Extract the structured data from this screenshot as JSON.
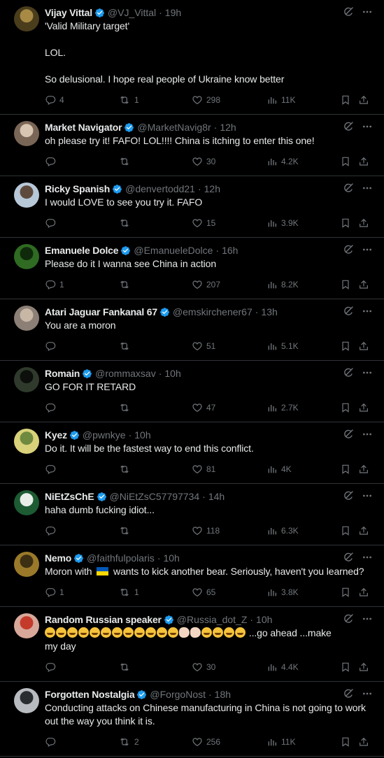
{
  "tweets": [
    {
      "name": "Vijay Vittal",
      "handle": "@VJ_Vittal",
      "time": "19h",
      "lines": [
        "'Valid Military target'",
        "",
        "LOL.",
        "",
        "So delusional. I hope real people of Ukraine know better"
      ],
      "replies": "4",
      "retweets": "1",
      "likes": "298",
      "views": "11K",
      "avatar_colors": [
        "#4a3d1c",
        "#a88a44"
      ]
    },
    {
      "name": "Market Navigator",
      "handle": "@MarketNavig8r",
      "time": "12h",
      "lines": [
        "oh please try it!  FAFO! LOL!!!!  China is itching to enter this one!"
      ],
      "replies": "",
      "retweets": "",
      "likes": "30",
      "views": "4.2K",
      "avatar_colors": [
        "#7a6656",
        "#d8c6b2"
      ]
    },
    {
      "name": "Ricky Spanish",
      "handle": "@denvertodd21",
      "time": "12h",
      "lines": [
        "I would LOVE to see you try it. FAFO"
      ],
      "replies": "",
      "retweets": "",
      "likes": "15",
      "views": "3.9K",
      "avatar_colors": [
        "#b7c8d8",
        "#5e4a3d"
      ]
    },
    {
      "name": "Emanuele Dolce",
      "handle": "@EmanueleDolce",
      "time": "16h",
      "lines": [
        "Please do it I wanna see China in action"
      ],
      "replies": "1",
      "retweets": "",
      "likes": "207",
      "views": "8.2K",
      "avatar_colors": [
        "#2f6b22",
        "#0f2a0b"
      ]
    },
    {
      "name": "Atari Jaguar Fankanal 67",
      "handle": "@emskirchener67",
      "time": "13h",
      "lines": [
        "You are a moron"
      ],
      "replies": "",
      "retweets": "",
      "likes": "51",
      "views": "5.1K",
      "avatar_colors": [
        "#8b7f76",
        "#c9b7a6"
      ]
    },
    {
      "name": "Romain",
      "handle": "@rommaxsav",
      "time": "10h",
      "lines": [
        "GO FOR IT RETARD"
      ],
      "replies": "",
      "retweets": "",
      "likes": "47",
      "views": "2.7K",
      "avatar_colors": [
        "#2f3a2c",
        "#0c0f0b"
      ]
    },
    {
      "name": "Kyez",
      "handle": "@pwnkye",
      "time": "10h",
      "lines": [
        "Do it. It will be the fastest way to end this conflict."
      ],
      "replies": "",
      "retweets": "",
      "likes": "81",
      "views": "4K",
      "avatar_colors": [
        "#d9d27a",
        "#6f8a3f"
      ]
    },
    {
      "name": "NiEtZsChE",
      "handle": "@NiEtZsC57797734",
      "time": "14h",
      "lines": [
        "haha dumb fucking idiot..."
      ],
      "replies": "",
      "retweets": "",
      "likes": "118",
      "views": "6.3K",
      "avatar_colors": [
        "#1d5b33",
        "#e8efe9"
      ]
    },
    {
      "name": "Nemo",
      "handle": "@faithfulpolaris",
      "time": "10h",
      "lines": [
        "Moron with {flag} wants to kick another bear. Seriously, haven't you learned?"
      ],
      "replies": "1",
      "retweets": "1",
      "likes": "65",
      "views": "3.8K",
      "avatar_colors": [
        "#9a7a2a",
        "#3c2f12"
      ]
    },
    {
      "name": "Random Russian speaker",
      "handle": "@Russia_dot_Z",
      "time": "10h",
      "lines": [
        "{emojis} ...go ahead ...make",
        "my day"
      ],
      "replies": "",
      "retweets": "",
      "likes": "30",
      "views": "4.4K",
      "avatar_colors": [
        "#d8a89a",
        "#c43b2c"
      ]
    },
    {
      "name": "Forgotten Nostalgia",
      "handle": "@ForgoNost",
      "time": "18h",
      "lines": [
        "Conducting attacks on Chinese manufacturing in China is not going to work",
        "out the way you think it is."
      ],
      "replies": "",
      "retweets": "2",
      "likes": "256",
      "views": "11K",
      "avatar_colors": [
        "#b8bcc0",
        "#2a2d30"
      ]
    }
  ],
  "colors": {
    "background": "#000000",
    "text": "#e7e9ea",
    "muted": "#71767b",
    "divider": "#2f3336",
    "verified": "#1d9bf0",
    "flag_blue": "#0057b7",
    "flag_yellow": "#ffd700"
  },
  "icons": {
    "verified": "verified-badge-icon",
    "grok": "grok-icon",
    "more": "more-icon",
    "reply": "reply-icon",
    "retweet": "retweet-icon",
    "like": "like-icon",
    "views": "views-icon",
    "bookmark": "bookmark-icon",
    "share": "share-icon"
  }
}
